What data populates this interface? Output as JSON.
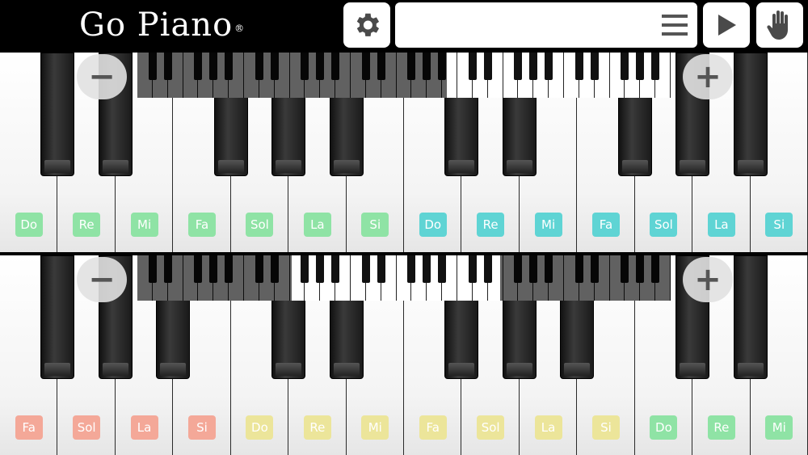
{
  "app": {
    "logo_text": "Go Piano",
    "registered_mark": "®"
  },
  "toolbar": {
    "settings_icon": "gear-icon",
    "song_title": "",
    "list_icon": "list-icon",
    "play_icon": "play-icon",
    "hand_icon": "hand-icon"
  },
  "keyboards": [
    {
      "zoom_out_label": "−",
      "zoom_in_label": "+",
      "visible_range": [
        0.58,
        1.0
      ],
      "notes": [
        {
          "label": "Do",
          "color": "#8fe3a5"
        },
        {
          "label": "Re",
          "color": "#8fe3a5"
        },
        {
          "label": "Mi",
          "color": "#8fe3a5"
        },
        {
          "label": "Fa",
          "color": "#8fe3a5"
        },
        {
          "label": "Sol",
          "color": "#8fe3a5"
        },
        {
          "label": "La",
          "color": "#8fe3a5"
        },
        {
          "label": "Si",
          "color": "#8fe3a5"
        },
        {
          "label": "Do",
          "color": "#5fd4d4"
        },
        {
          "label": "Re",
          "color": "#5fd4d4"
        },
        {
          "label": "Mi",
          "color": "#5fd4d4"
        },
        {
          "label": "Fa",
          "color": "#5fd4d4"
        },
        {
          "label": "Sol",
          "color": "#5fd4d4"
        },
        {
          "label": "La",
          "color": "#5fd4d4"
        },
        {
          "label": "Si",
          "color": "#5fd4d4"
        }
      ],
      "black_after": [
        0,
        1,
        3,
        4,
        5,
        7,
        8,
        10,
        11,
        12
      ]
    },
    {
      "zoom_out_label": "−",
      "zoom_in_label": "+",
      "visible_range": [
        0.29,
        0.68
      ],
      "notes": [
        {
          "label": "Fa",
          "color": "#f4a898"
        },
        {
          "label": "Sol",
          "color": "#f4a898"
        },
        {
          "label": "La",
          "color": "#f4a898"
        },
        {
          "label": "Si",
          "color": "#f4a898"
        },
        {
          "label": "Do",
          "color": "#ece59a"
        },
        {
          "label": "Re",
          "color": "#ece59a"
        },
        {
          "label": "Mi",
          "color": "#ece59a"
        },
        {
          "label": "Fa",
          "color": "#ece59a"
        },
        {
          "label": "Sol",
          "color": "#ece59a"
        },
        {
          "label": "La",
          "color": "#ece59a"
        },
        {
          "label": "Si",
          "color": "#ece59a"
        },
        {
          "label": "Do",
          "color": "#8fe3a5"
        },
        {
          "label": "Re",
          "color": "#8fe3a5"
        },
        {
          "label": "Mi",
          "color": "#8fe3a5"
        }
      ],
      "black_after": [
        0,
        1,
        2,
        4,
        5,
        7,
        8,
        9,
        11,
        12
      ]
    }
  ]
}
